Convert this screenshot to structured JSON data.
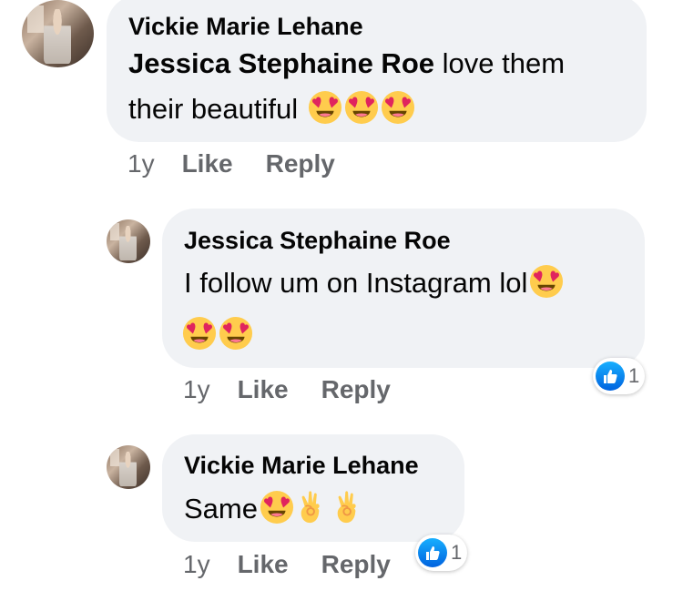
{
  "comments": [
    {
      "author": "Vickie Marie Lehane",
      "mention": "Jessica Stephaine Roe",
      "text_line1": " love them",
      "text_line2": "their beautiful ",
      "time": "1y",
      "like_label": "Like",
      "reply_label": "Reply"
    },
    {
      "author": "Jessica Stephaine Roe",
      "text_line1": "I follow um on Instagram lol",
      "time": "1y",
      "like_label": "Like",
      "reply_label": "Reply",
      "reaction_count": "1"
    },
    {
      "author": "Vickie Marie Lehane",
      "text_line1": "Same",
      "time": "1y",
      "like_label": "Like",
      "reply_label": "Reply",
      "reaction_count": "1"
    }
  ],
  "colors": {
    "bubble": "#f0f2f5",
    "meta_text": "#65676b",
    "like_blue": "#1877f2"
  },
  "icons": [
    "heart-eyes-emoji-icon",
    "ok-hand-emoji-icon",
    "like-thumb-icon"
  ]
}
